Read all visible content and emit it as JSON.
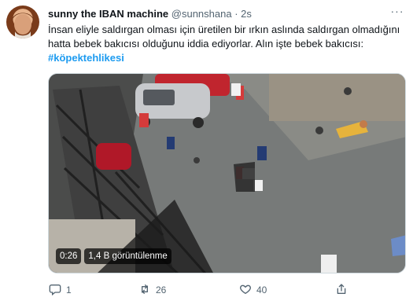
{
  "tweet": {
    "author_name": "sunny the IBAN machine",
    "author_handle": "@sunnshana",
    "separator": "·",
    "time": "2s",
    "more_label": "···",
    "text_main": "İnsan eliyle saldırgan olması için üretilen bir ırkın aslında saldırgan olmadığını hatta bebek bakıcısı olduğunu iddia ediyorlar. Alın işte bebek bakıcısı: ",
    "hashtag": "#köpektehlikesi"
  },
  "video": {
    "duration": "0:26",
    "views": "1,4 B görüntülenme"
  },
  "actions": {
    "reply_count": "1",
    "retweet_count": "26",
    "like_count": "40",
    "share_count": ""
  },
  "icons": {
    "reply": "reply-icon",
    "retweet": "retweet-icon",
    "like": "heart-icon",
    "share": "share-icon"
  }
}
